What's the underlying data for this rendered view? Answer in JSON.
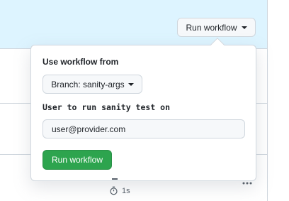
{
  "header": {
    "run_workflow_label": "Run workflow"
  },
  "popup": {
    "heading": "Use workflow from",
    "branch_label": "Branch: sanity-args",
    "input_label": "User to run sanity test on",
    "input_value": "user@provider.com",
    "submit_label": "Run workflow"
  },
  "row": {
    "duration": "1s",
    "more_icon": "kebab-horizontal-icon"
  },
  "colors": {
    "header_bg": "#ddf4ff",
    "primary_green": "#2da44e",
    "border": "#d0d7de"
  }
}
